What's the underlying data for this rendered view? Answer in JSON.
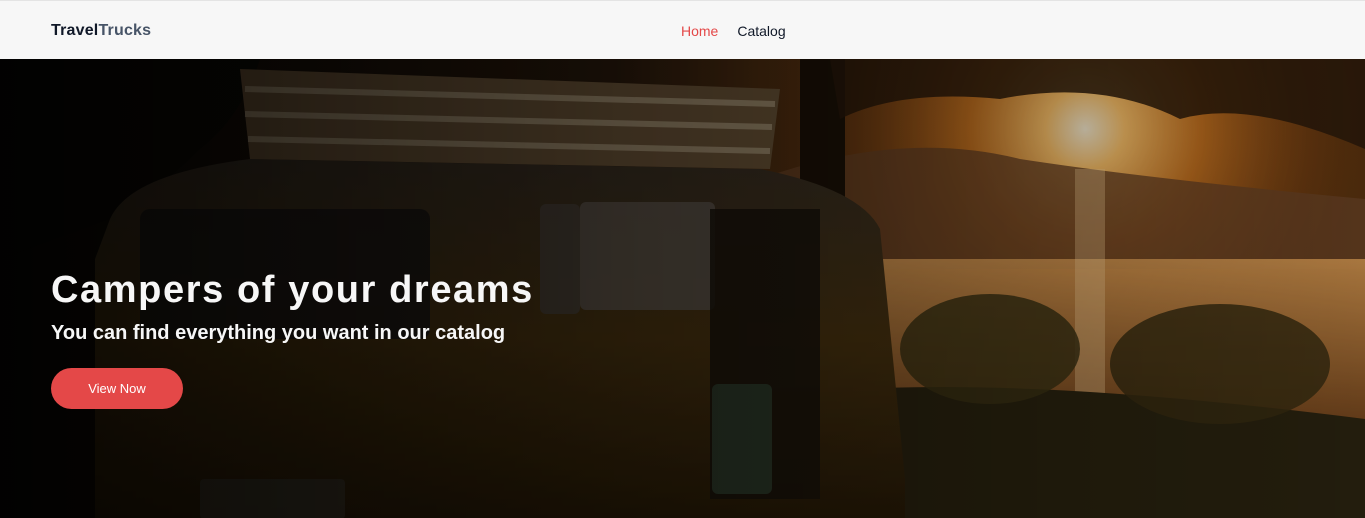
{
  "header": {
    "logo_part1": "Travel",
    "logo_part2": "Trucks",
    "nav": [
      {
        "label": "Home",
        "active": true
      },
      {
        "label": "Catalog",
        "active": false
      }
    ]
  },
  "hero": {
    "title": "Campers of your dreams",
    "subtitle": "You can find everything you want in our catalog",
    "button_label": "View Now"
  },
  "colors": {
    "accent": "#e44848",
    "text_dark": "#101828",
    "header_bg": "#f7f7f7",
    "hero_text": "#f7f7f7"
  }
}
